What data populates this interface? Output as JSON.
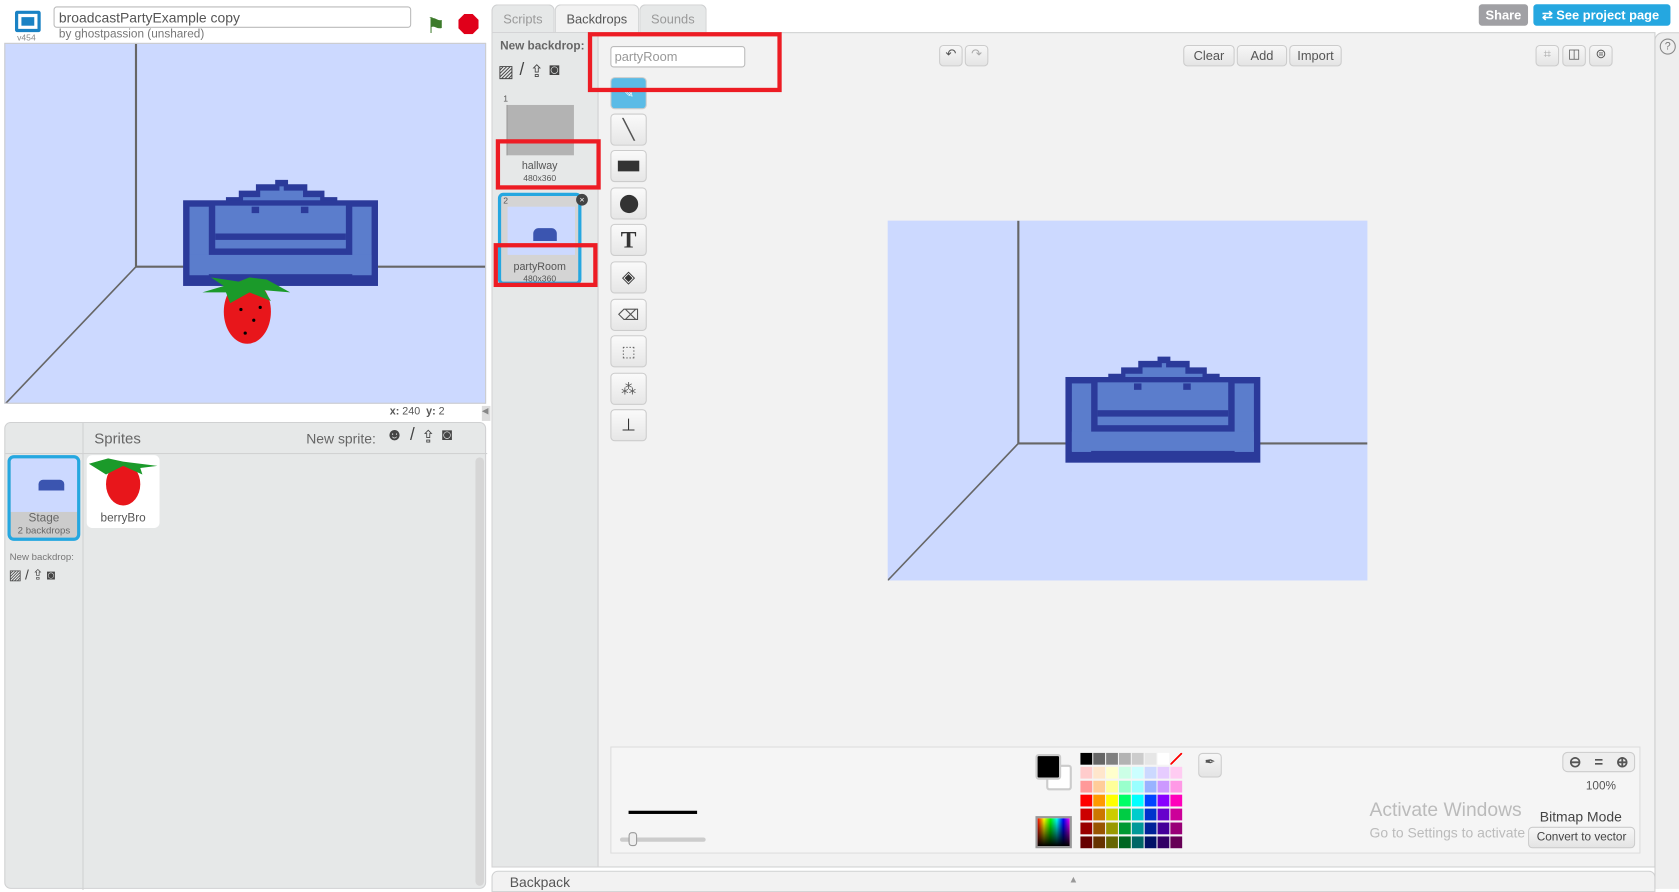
{
  "header": {
    "version": "v454",
    "project_title": "broadcastPartyExample copy",
    "author": "by ghostpassion (unshared)",
    "share_label": "Share",
    "see_project_label": "See project page"
  },
  "stage": {
    "coords_x_label": "x:",
    "coords_x": "240",
    "coords_y_label": "y:",
    "coords_y": "2",
    "background": "#ccd9ff"
  },
  "sprites_panel": {
    "title": "Sprites",
    "new_sprite_label": "New sprite:",
    "stage_name": "Stage",
    "stage_sub": "2 backdrops",
    "new_backdrop_label": "New backdrop:",
    "sprites": [
      {
        "name": "berryBro"
      }
    ]
  },
  "tabs": [
    {
      "label": "Scripts"
    },
    {
      "label": "Backdrops",
      "active": true
    },
    {
      "label": "Sounds"
    }
  ],
  "backdrops": {
    "new_backdrop_label": "New backdrop:",
    "items": [
      {
        "index": "1",
        "name": "hallway",
        "size": "480x360"
      },
      {
        "index": "2",
        "name": "partyRoom",
        "size": "480x360",
        "selected": true
      }
    ]
  },
  "editor": {
    "costume_name": "partyRoom",
    "clear_label": "Clear",
    "add_label": "Add",
    "import_label": "Import",
    "zoom_level": "100%",
    "mode_label": "Bitmap Mode",
    "convert_label": "Convert to vector",
    "tools": [
      "brush-icon",
      "line-icon",
      "rectangle-icon",
      "ellipse-icon",
      "text-icon",
      "fill-icon",
      "eraser-icon",
      "select-icon",
      "magic-select-icon",
      "stamp-icon"
    ],
    "primary_color": "#000000",
    "secondary_color": "#ffffff",
    "palette": [
      [
        "#000000",
        "#666666",
        "#808080",
        "#b3b3b3",
        "#cccccc",
        "#e6e6e6",
        "#ffffff",
        "none"
      ],
      [
        "#ffcccc",
        "#ffe6cc",
        "#ffffcc",
        "#ccffe6",
        "#ccffff",
        "#ccd9ff",
        "#e6ccff",
        "#ffccf2"
      ],
      [
        "#ff9999",
        "#ffcc99",
        "#ffff99",
        "#99ffcc",
        "#99ffff",
        "#99b3ff",
        "#cc99ff",
        "#ff99e6"
      ],
      [
        "#ff0000",
        "#ff9900",
        "#ffff00",
        "#00ff66",
        "#00ffff",
        "#0044ff",
        "#8800ff",
        "#ff00bb"
      ],
      [
        "#cc0000",
        "#cc7700",
        "#cccc00",
        "#00cc44",
        "#00cccc",
        "#0033cc",
        "#6600cc",
        "#cc0099"
      ],
      [
        "#990000",
        "#995500",
        "#999900",
        "#009933",
        "#009999",
        "#002299",
        "#440099",
        "#990077"
      ],
      [
        "#660000",
        "#663300",
        "#666600",
        "#006622",
        "#006666",
        "#001166",
        "#330066",
        "#660055"
      ]
    ]
  },
  "backpack": {
    "label": "Backpack"
  },
  "watermark": {
    "title": "Activate Windows",
    "subtitle": "Go to Settings to activate Windows."
  },
  "colors": {
    "accent": "#25a7e0",
    "highlight": "#ed1c24"
  }
}
